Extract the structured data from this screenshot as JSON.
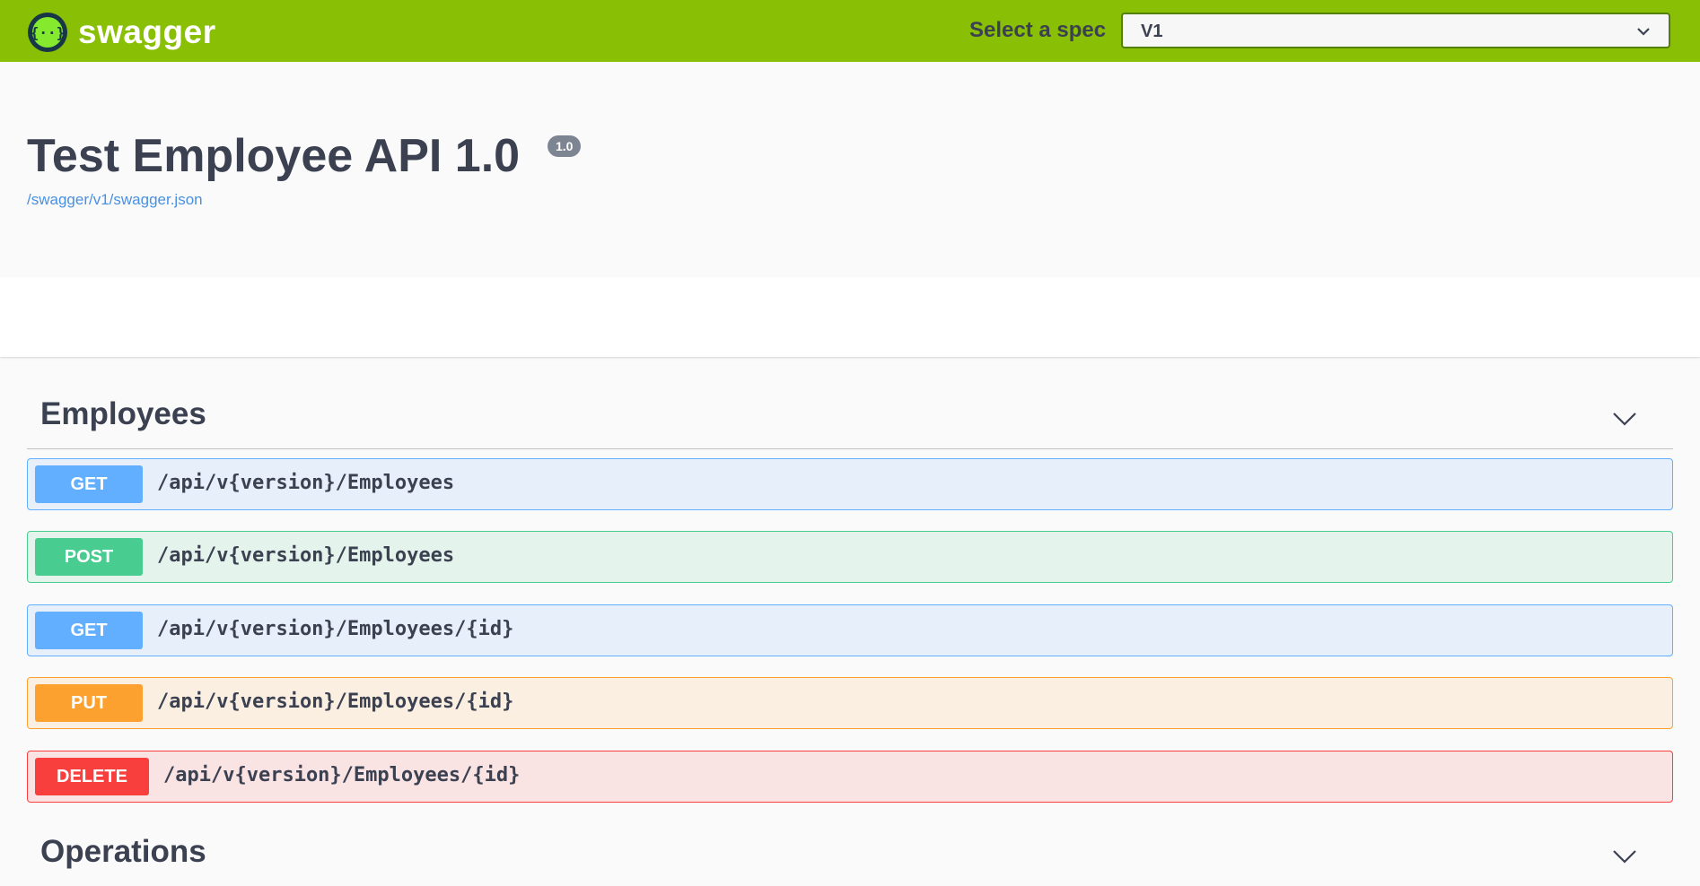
{
  "topbar": {
    "logo_text": "swagger",
    "spec_label": "Select a spec",
    "spec_value": "V1"
  },
  "info": {
    "title": "Test Employee API 1.0",
    "version": "1.0",
    "spec_url": "/swagger/v1/swagger.json"
  },
  "tags": [
    {
      "name": "Employees",
      "operations": [
        {
          "method": "GET",
          "path": "/api/v{version}/Employees"
        },
        {
          "method": "POST",
          "path": "/api/v{version}/Employees"
        },
        {
          "method": "GET",
          "path": "/api/v{version}/Employees/{id}"
        },
        {
          "method": "PUT",
          "path": "/api/v{version}/Employees/{id}"
        },
        {
          "method": "DELETE",
          "path": "/api/v{version}/Employees/{id}"
        }
      ]
    },
    {
      "name": "Operations",
      "operations": []
    }
  ],
  "colors": {
    "topbar": "#89bf04",
    "get": "#61affe",
    "post": "#49cc90",
    "put": "#fca130",
    "delete": "#f93e3e"
  }
}
